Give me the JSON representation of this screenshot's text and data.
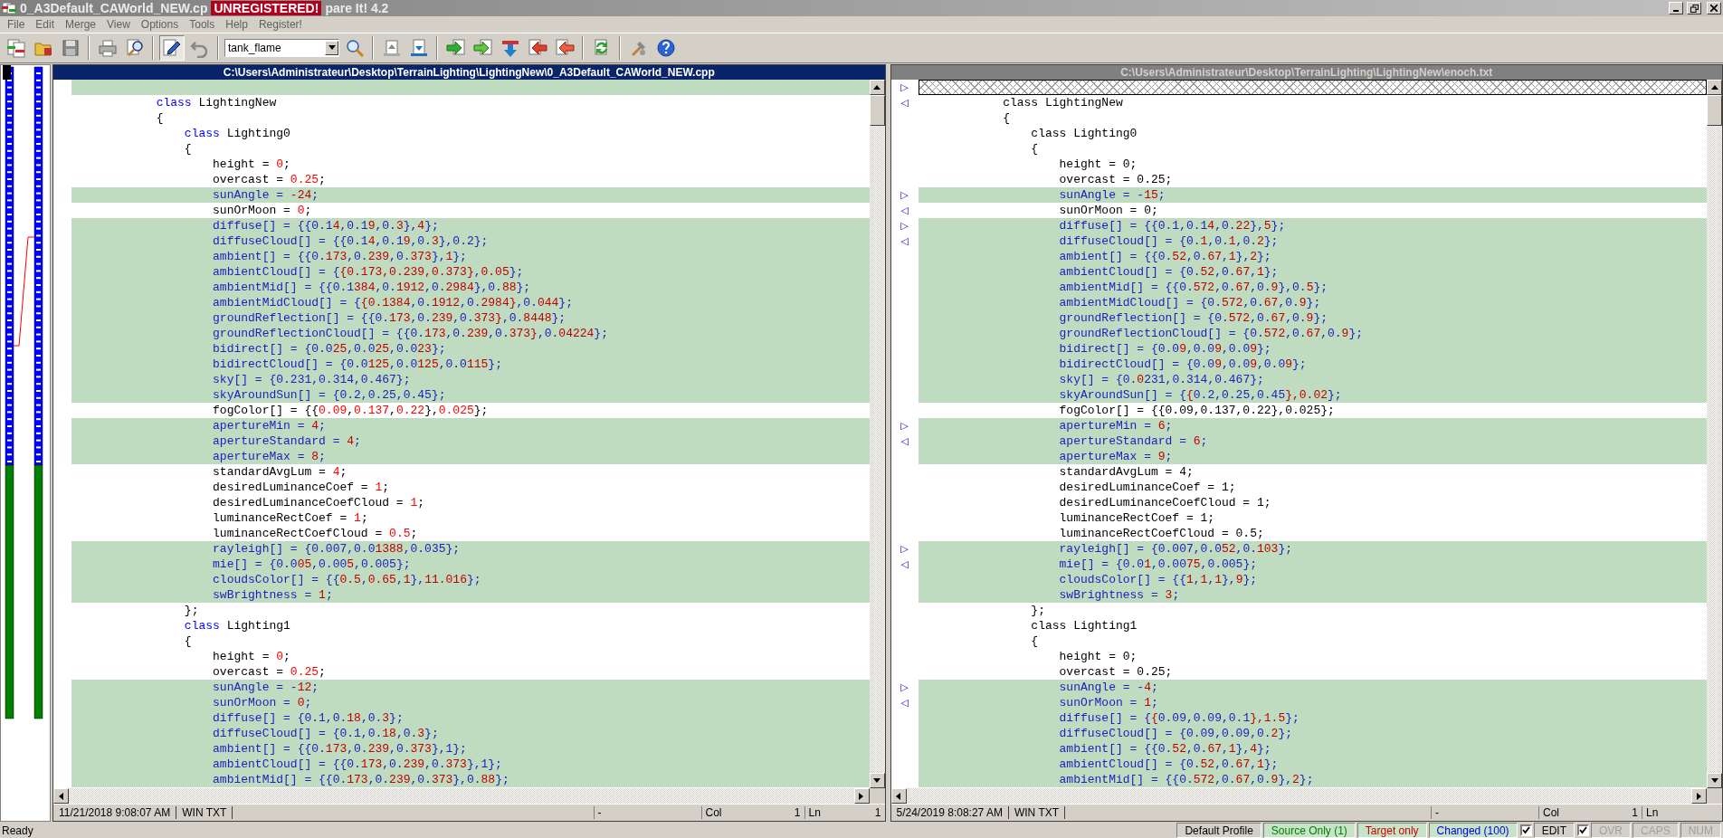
{
  "window": {
    "title": "0_A3Default_CAWorld_NEW.cp",
    "badge": "UNREGISTERED!",
    "title_end": "pare It! 4.2"
  },
  "menu": [
    "File",
    "Edit",
    "Merge",
    "View",
    "Options",
    "Tools",
    "Help",
    "Register!"
  ],
  "toolbar": {
    "search_text": "tank_flame",
    "edit_pressed": true
  },
  "panes": [
    {
      "path": "C:\\Users\\Administrateur\\Desktop\\TerrainLighting\\LightingNew\\0_A3Default_CAWorld_NEW.cpp",
      "active": true,
      "lines": [
        {
          "kind": "changed"
        },
        {
          "kind": "same",
          "parts": [
            {
              "text": "            class",
              "kind": "keyword"
            },
            {
              "text": " LightingNew"
            }
          ]
        },
        {
          "kind": "same",
          "parts": [
            {
              "text": "            {"
            }
          ]
        },
        {
          "kind": "same",
          "parts": [
            {
              "text": "                class",
              "kind": "keyword"
            },
            {
              "text": " Lighting0"
            }
          ]
        },
        {
          "kind": "same",
          "parts": [
            {
              "text": "                {"
            }
          ]
        },
        {
          "kind": "same",
          "parts": [
            {
              "text": "                    height = "
            },
            {
              "text": "0",
              "kind": "number"
            },
            {
              "text": ";"
            }
          ]
        },
        {
          "kind": "same",
          "parts": [
            {
              "text": "                    overcast = "
            },
            {
              "text": "0.25",
              "kind": "number"
            },
            {
              "text": ";"
            }
          ]
        },
        {
          "kind": "changed",
          "parts": [
            {
              "text": "                    sunAngle = "
            },
            {
              "text": "-24",
              "kind": "diff"
            },
            {
              "text": ";"
            }
          ]
        },
        {
          "kind": "same",
          "parts": [
            {
              "text": "                    sunOrMoon = "
            },
            {
              "text": "0",
              "kind": "number"
            },
            {
              "text": ";"
            }
          ]
        },
        {
          "kind": "changed",
          "parts": [
            {
              "text": "                    diffuse[] = {{0.1"
            },
            {
              "text": "4",
              "kind": "diff"
            },
            {
              "text": ",0.1"
            },
            {
              "text": "9",
              "kind": "diff"
            },
            {
              "text": ",0."
            },
            {
              "text": "3",
              "kind": "diff"
            },
            {
              "text": "},"
            },
            {
              "text": "4",
              "kind": "diff"
            },
            {
              "text": "};"
            }
          ]
        },
        {
          "kind": "changed",
          "parts": [
            {
              "text": "                    diffuseCloud[] = {{0.1"
            },
            {
              "text": "4",
              "kind": "diff"
            },
            {
              "text": ",0.1"
            },
            {
              "text": "9",
              "kind": "diff"
            },
            {
              "text": ",0."
            },
            {
              "text": "3",
              "kind": "diff"
            },
            {
              "text": "},0.2};"
            }
          ]
        },
        {
          "kind": "changed",
          "parts": [
            {
              "text": "                    ambient[] = {{0."
            },
            {
              "text": "173",
              "kind": "diff"
            },
            {
              "text": ",0."
            },
            {
              "text": "239",
              "kind": "diff"
            },
            {
              "text": ",0."
            },
            {
              "text": "373",
              "kind": "diff"
            },
            {
              "text": "},"
            },
            {
              "text": "1",
              "kind": "diff"
            },
            {
              "text": "};"
            }
          ]
        },
        {
          "kind": "changed",
          "parts": [
            {
              "text": "                    ambientCloud[] = {"
            },
            {
              "text": "{0.173,0.239,0.373}",
              "kind": "diff"
            },
            {
              "text": ","
            },
            {
              "text": "0.05",
              "kind": "diff"
            },
            {
              "text": "};"
            }
          ]
        },
        {
          "kind": "changed",
          "parts": [
            {
              "text": "                    ambientMid[] = {{0.1"
            },
            {
              "text": "384",
              "kind": "diff"
            },
            {
              "text": ",0."
            },
            {
              "text": "1912",
              "kind": "diff"
            },
            {
              "text": ",0."
            },
            {
              "text": "2984",
              "kind": "diff"
            },
            {
              "text": "},0."
            },
            {
              "text": "88",
              "kind": "diff"
            },
            {
              "text": "};"
            }
          ]
        },
        {
          "kind": "changed",
          "parts": [
            {
              "text": "                    ambientMidCloud[] = {"
            },
            {
              "text": "{0.1384",
              "kind": "diff"
            },
            {
              "text": ",0."
            },
            {
              "text": "1912",
              "kind": "diff"
            },
            {
              "text": ",0."
            },
            {
              "text": "2984}",
              "kind": "diff"
            },
            {
              "text": ",0."
            },
            {
              "text": "044",
              "kind": "diff"
            },
            {
              "text": "};"
            }
          ]
        },
        {
          "kind": "changed",
          "parts": [
            {
              "text": "                    groundReflection[] = {{0."
            },
            {
              "text": "173",
              "kind": "diff"
            },
            {
              "text": ",0."
            },
            {
              "text": "239",
              "kind": "diff"
            },
            {
              "text": ",0."
            },
            {
              "text": "373}",
              "kind": "diff"
            },
            {
              "text": ",0."
            },
            {
              "text": "8448",
              "kind": "diff"
            },
            {
              "text": "};"
            }
          ]
        },
        {
          "kind": "changed",
          "parts": [
            {
              "text": "                    groundReflectionCloud[] = {{0."
            },
            {
              "text": "173",
              "kind": "diff"
            },
            {
              "text": ",0."
            },
            {
              "text": "239",
              "kind": "diff"
            },
            {
              "text": ",0."
            },
            {
              "text": "373}",
              "kind": "diff"
            },
            {
              "text": ",0."
            },
            {
              "text": "04224",
              "kind": "diff"
            },
            {
              "text": "};"
            }
          ]
        },
        {
          "kind": "changed",
          "parts": [
            {
              "text": "                    bidirect[] = {0.0"
            },
            {
              "text": "25",
              "kind": "diff"
            },
            {
              "text": ",0.0"
            },
            {
              "text": "25",
              "kind": "diff"
            },
            {
              "text": ",0.0"
            },
            {
              "text": "23",
              "kind": "diff"
            },
            {
              "text": "};"
            }
          ]
        },
        {
          "kind": "changed",
          "parts": [
            {
              "text": "                    bidirectCloud[] = {0.0"
            },
            {
              "text": "125",
              "kind": "diff"
            },
            {
              "text": ",0.0"
            },
            {
              "text": "125",
              "kind": "diff"
            },
            {
              "text": ",0.0"
            },
            {
              "text": "115",
              "kind": "diff"
            },
            {
              "text": "};"
            }
          ]
        },
        {
          "kind": "changed",
          "parts": [
            {
              "text": "                    sky[] = {0.231,0.314,0.467};"
            }
          ]
        },
        {
          "kind": "changed",
          "parts": [
            {
              "text": "                    skyAroundSun[] = {0.2,0.25,0.45};"
            }
          ]
        },
        {
          "kind": "same",
          "parts": [
            {
              "text": "                    fogColor[] = {{"
            },
            {
              "text": "0.09",
              "kind": "number"
            },
            {
              "text": ","
            },
            {
              "text": "0.137",
              "kind": "number"
            },
            {
              "text": ","
            },
            {
              "text": "0.22",
              "kind": "number"
            },
            {
              "text": "},"
            },
            {
              "text": "0.025",
              "kind": "number"
            },
            {
              "text": "};"
            }
          ]
        },
        {
          "kind": "changed",
          "parts": [
            {
              "text": "                    apertureMin = "
            },
            {
              "text": "4",
              "kind": "diff"
            },
            {
              "text": ";"
            }
          ]
        },
        {
          "kind": "changed",
          "parts": [
            {
              "text": "                    apertureStandard = "
            },
            {
              "text": "4",
              "kind": "diff"
            },
            {
              "text": ";"
            }
          ]
        },
        {
          "kind": "changed",
          "parts": [
            {
              "text": "                    apertureMax = "
            },
            {
              "text": "8",
              "kind": "diff"
            },
            {
              "text": ";"
            }
          ]
        },
        {
          "kind": "same",
          "parts": [
            {
              "text": "                    standardAvgLum = "
            },
            {
              "text": "4",
              "kind": "number"
            },
            {
              "text": ";"
            }
          ]
        },
        {
          "kind": "same",
          "parts": [
            {
              "text": "                    desiredLuminanceCoef = "
            },
            {
              "text": "1",
              "kind": "number"
            },
            {
              "text": ";"
            }
          ]
        },
        {
          "kind": "same",
          "parts": [
            {
              "text": "                    desiredLuminanceCoefCloud = "
            },
            {
              "text": "1",
              "kind": "number"
            },
            {
              "text": ";"
            }
          ]
        },
        {
          "kind": "same",
          "parts": [
            {
              "text": "                    luminanceRectCoef = "
            },
            {
              "text": "1",
              "kind": "number"
            },
            {
              "text": ";"
            }
          ]
        },
        {
          "kind": "same",
          "parts": [
            {
              "text": "                    luminanceRectCoefCloud = "
            },
            {
              "text": "0.5",
              "kind": "number"
            },
            {
              "text": ";"
            }
          ]
        },
        {
          "kind": "changed",
          "parts": [
            {
              "text": "                    rayleigh[] = {0.007,0.0"
            },
            {
              "text": "1388",
              "kind": "diff"
            },
            {
              "text": ",0.035};"
            }
          ]
        },
        {
          "kind": "changed",
          "parts": [
            {
              "text": "                    mie[] = {0.0"
            },
            {
              "text": "05",
              "kind": "diff"
            },
            {
              "text": ",0.00"
            },
            {
              "text": "5",
              "kind": "diff"
            },
            {
              "text": ",0.005};"
            }
          ]
        },
        {
          "kind": "changed",
          "parts": [
            {
              "text": "                    cloudsColor[] = {{"
            },
            {
              "text": "0.5",
              "kind": "diff"
            },
            {
              "text": ","
            },
            {
              "text": "0.65",
              "kind": "diff"
            },
            {
              "text": ","
            },
            {
              "text": "1",
              "kind": "diff"
            },
            {
              "text": "},"
            },
            {
              "text": "11.016",
              "kind": "diff"
            },
            {
              "text": "};"
            }
          ]
        },
        {
          "kind": "changed",
          "parts": [
            {
              "text": "                    swBrightness = "
            },
            {
              "text": "1",
              "kind": "diff"
            },
            {
              "text": ";"
            }
          ]
        },
        {
          "kind": "same",
          "parts": [
            {
              "text": "                };"
            }
          ]
        },
        {
          "kind": "same",
          "parts": [
            {
              "text": "                class",
              "kind": "keyword"
            },
            {
              "text": " Lighting1"
            }
          ]
        },
        {
          "kind": "same",
          "parts": [
            {
              "text": "                {"
            }
          ]
        },
        {
          "kind": "same",
          "parts": [
            {
              "text": "                    height = "
            },
            {
              "text": "0",
              "kind": "number"
            },
            {
              "text": ";"
            }
          ]
        },
        {
          "kind": "same",
          "parts": [
            {
              "text": "                    overcast = "
            },
            {
              "text": "0.25",
              "kind": "number"
            },
            {
              "text": ";"
            }
          ]
        },
        {
          "kind": "changed",
          "parts": [
            {
              "text": "                    sunAngle = -"
            },
            {
              "text": "12",
              "kind": "diff"
            },
            {
              "text": ";"
            }
          ]
        },
        {
          "kind": "changed",
          "parts": [
            {
              "text": "                    sunOrMoon = "
            },
            {
              "text": "0",
              "kind": "diff"
            },
            {
              "text": ";"
            }
          ]
        },
        {
          "kind": "changed",
          "parts": [
            {
              "text": "                    diffuse[] = {0.1,0."
            },
            {
              "text": "18",
              "kind": "diff"
            },
            {
              "text": ",0."
            },
            {
              "text": "3",
              "kind": "diff"
            },
            {
              "text": "};"
            }
          ]
        },
        {
          "kind": "changed",
          "parts": [
            {
              "text": "                    diffuseCloud[] = {0.1,0."
            },
            {
              "text": "18",
              "kind": "diff"
            },
            {
              "text": ",0."
            },
            {
              "text": "3",
              "kind": "diff"
            },
            {
              "text": "};"
            }
          ]
        },
        {
          "kind": "changed",
          "parts": [
            {
              "text": "                    ambient[] = {{0."
            },
            {
              "text": "173",
              "kind": "diff"
            },
            {
              "text": ",0."
            },
            {
              "text": "239",
              "kind": "diff"
            },
            {
              "text": ",0."
            },
            {
              "text": "373",
              "kind": "diff"
            },
            {
              "text": "},1};"
            }
          ]
        },
        {
          "kind": "changed",
          "parts": [
            {
              "text": "                    ambientCloud[] = {{0."
            },
            {
              "text": "173",
              "kind": "diff"
            },
            {
              "text": ",0."
            },
            {
              "text": "239",
              "kind": "diff"
            },
            {
              "text": ",0."
            },
            {
              "text": "373",
              "kind": "diff"
            },
            {
              "text": "},1};"
            }
          ]
        },
        {
          "kind": "changed",
          "parts": [
            {
              "text": "                    ambientMid[] = {{0."
            },
            {
              "text": "173",
              "kind": "diff"
            },
            {
              "text": ",0."
            },
            {
              "text": "239",
              "kind": "diff"
            },
            {
              "text": ",0."
            },
            {
              "text": "373",
              "kind": "diff"
            },
            {
              "text": "},0."
            },
            {
              "text": "88",
              "kind": "diff"
            },
            {
              "text": "};"
            }
          ]
        }
      ],
      "status": {
        "date": "11/21/2018  9:08:07 AM",
        "format": "WIN TXT",
        "position": "-",
        "col_label": "Col",
        "col_value": "1",
        "ln_label": "Ln",
        "ln_value": "1"
      }
    },
    {
      "path": "C:\\Users\\Administrateur\\Desktop\\TerrainLighting\\LightingNew\\enoch.txt",
      "active": false,
      "lines": [
        {
          "kind": "missing",
          "marker": "▷"
        },
        {
          "kind": "same",
          "marker": "◁",
          "parts": [
            {
              "text": "            class LightingNew"
            }
          ]
        },
        {
          "kind": "same",
          "parts": [
            {
              "text": "            {"
            }
          ]
        },
        {
          "kind": "same",
          "parts": [
            {
              "text": "                class Lighting0"
            }
          ]
        },
        {
          "kind": "same",
          "parts": [
            {
              "text": "                {"
            }
          ]
        },
        {
          "kind": "same",
          "parts": [
            {
              "text": "                    height = 0;"
            }
          ]
        },
        {
          "kind": "same",
          "parts": [
            {
              "text": "                    overcast = 0.25;"
            }
          ]
        },
        {
          "kind": "changed",
          "marker": "▷",
          "parts": [
            {
              "text": "                    sunAngle = -"
            },
            {
              "text": "15",
              "kind": "diff"
            },
            {
              "text": ";"
            }
          ]
        },
        {
          "kind": "same",
          "marker": "◁",
          "parts": [
            {
              "text": "                    sunOrMoon = 0;"
            }
          ]
        },
        {
          "kind": "changed",
          "marker": "▷",
          "parts": [
            {
              "text": "                    diffuse[] = {{0.1,0.1"
            },
            {
              "text": "4",
              "kind": "diff"
            },
            {
              "text": ",0."
            },
            {
              "text": "22",
              "kind": "diff"
            },
            {
              "text": "},"
            },
            {
              "text": "5",
              "kind": "diff"
            },
            {
              "text": "};"
            }
          ]
        },
        {
          "kind": "changed",
          "marker": "◁",
          "parts": [
            {
              "text": "                    diffuseCloud[] = {0."
            },
            {
              "text": "1",
              "kind": "diff"
            },
            {
              "text": ",0."
            },
            {
              "text": "1",
              "kind": "diff"
            },
            {
              "text": ",0."
            },
            {
              "text": "2",
              "kind": "diff"
            },
            {
              "text": "};"
            }
          ]
        },
        {
          "kind": "changed",
          "parts": [
            {
              "text": "                    ambient[] = {{0."
            },
            {
              "text": "52",
              "kind": "diff"
            },
            {
              "text": ",0."
            },
            {
              "text": "67",
              "kind": "diff"
            },
            {
              "text": ","
            },
            {
              "text": "1",
              "kind": "diff"
            },
            {
              "text": "},"
            },
            {
              "text": "2",
              "kind": "diff"
            },
            {
              "text": "};"
            }
          ]
        },
        {
          "kind": "changed",
          "parts": [
            {
              "text": "                    ambientCloud[] = {0."
            },
            {
              "text": "52",
              "kind": "diff"
            },
            {
              "text": ",0."
            },
            {
              "text": "67",
              "kind": "diff"
            },
            {
              "text": ","
            },
            {
              "text": "1",
              "kind": "diff"
            },
            {
              "text": "};"
            }
          ]
        },
        {
          "kind": "changed",
          "parts": [
            {
              "text": "                    ambientMid[] = {{0."
            },
            {
              "text": "572",
              "kind": "diff"
            },
            {
              "text": ",0."
            },
            {
              "text": "67",
              "kind": "diff"
            },
            {
              "text": ",0."
            },
            {
              "text": "9",
              "kind": "diff"
            },
            {
              "text": "},0."
            },
            {
              "text": "5",
              "kind": "diff"
            },
            {
              "text": "};"
            }
          ]
        },
        {
          "kind": "changed",
          "parts": [
            {
              "text": "                    ambientMidCloud[] = {0."
            },
            {
              "text": "572",
              "kind": "diff"
            },
            {
              "text": ",0."
            },
            {
              "text": "67",
              "kind": "diff"
            },
            {
              "text": ",0."
            },
            {
              "text": "9",
              "kind": "diff"
            },
            {
              "text": "};"
            }
          ]
        },
        {
          "kind": "changed",
          "parts": [
            {
              "text": "                    groundReflection[] = {0."
            },
            {
              "text": "572",
              "kind": "diff"
            },
            {
              "text": ",0."
            },
            {
              "text": "67",
              "kind": "diff"
            },
            {
              "text": ",0."
            },
            {
              "text": "9",
              "kind": "diff"
            },
            {
              "text": "};"
            }
          ]
        },
        {
          "kind": "changed",
          "parts": [
            {
              "text": "                    groundReflectionCloud[] = {0."
            },
            {
              "text": "572",
              "kind": "diff"
            },
            {
              "text": ",0."
            },
            {
              "text": "67",
              "kind": "diff"
            },
            {
              "text": ",0."
            },
            {
              "text": "9",
              "kind": "diff"
            },
            {
              "text": "};"
            }
          ]
        },
        {
          "kind": "changed",
          "parts": [
            {
              "text": "                    bidirect[] = {0.0"
            },
            {
              "text": "9",
              "kind": "diff"
            },
            {
              "text": ",0.0"
            },
            {
              "text": "9",
              "kind": "diff"
            },
            {
              "text": ",0.0"
            },
            {
              "text": "9",
              "kind": "diff"
            },
            {
              "text": "};"
            }
          ]
        },
        {
          "kind": "changed",
          "parts": [
            {
              "text": "                    bidirectCloud[] = {0.0"
            },
            {
              "text": "9",
              "kind": "diff"
            },
            {
              "text": ",0.0"
            },
            {
              "text": "9",
              "kind": "diff"
            },
            {
              "text": ",0.0"
            },
            {
              "text": "9",
              "kind": "diff"
            },
            {
              "text": "};"
            }
          ]
        },
        {
          "kind": "changed",
          "parts": [
            {
              "text": "                    sky[] = {0."
            },
            {
              "text": "0",
              "kind": "diff"
            },
            {
              "text": "231,0.314,0.467};"
            }
          ]
        },
        {
          "kind": "changed",
          "parts": [
            {
              "text": "                    skyAroundSun[] = {"
            },
            {
              "text": "{",
              "kind": "diff"
            },
            {
              "text": "0.2,0.25,0.45"
            },
            {
              "text": "},0.02",
              "kind": "diff"
            },
            {
              "text": "};"
            }
          ]
        },
        {
          "kind": "same",
          "parts": [
            {
              "text": "                    fogColor[] = {{0.09,0.137,0.22},0.025};"
            }
          ]
        },
        {
          "kind": "changed",
          "marker": "▷",
          "parts": [
            {
              "text": "                    apertureMin = "
            },
            {
              "text": "6",
              "kind": "diff"
            },
            {
              "text": ";"
            }
          ]
        },
        {
          "kind": "changed",
          "marker": "◁",
          "parts": [
            {
              "text": "                    apertureStandard = "
            },
            {
              "text": "6",
              "kind": "diff"
            },
            {
              "text": ";"
            }
          ]
        },
        {
          "kind": "changed",
          "parts": [
            {
              "text": "                    apertureMax = "
            },
            {
              "text": "9",
              "kind": "diff"
            },
            {
              "text": ";"
            }
          ]
        },
        {
          "kind": "same",
          "parts": [
            {
              "text": "                    standardAvgLum = 4;"
            }
          ]
        },
        {
          "kind": "same",
          "parts": [
            {
              "text": "                    desiredLuminanceCoef = 1;"
            }
          ]
        },
        {
          "kind": "same",
          "parts": [
            {
              "text": "                    desiredLuminanceCoefCloud = 1;"
            }
          ]
        },
        {
          "kind": "same",
          "parts": [
            {
              "text": "                    luminanceRectCoef = 1;"
            }
          ]
        },
        {
          "kind": "same",
          "parts": [
            {
              "text": "                    luminanceRectCoefCloud = 0.5;"
            }
          ]
        },
        {
          "kind": "changed",
          "marker": "▷",
          "parts": [
            {
              "text": "                    rayleigh[] = {0.007,0.0"
            },
            {
              "text": "52",
              "kind": "diff"
            },
            {
              "text": ",0."
            },
            {
              "text": "103",
              "kind": "diff"
            },
            {
              "text": "};"
            }
          ]
        },
        {
          "kind": "changed",
          "marker": "◁",
          "parts": [
            {
              "text": "                    mie[] = {0.0"
            },
            {
              "text": "1",
              "kind": "diff"
            },
            {
              "text": ",0.00"
            },
            {
              "text": "75",
              "kind": "diff"
            },
            {
              "text": ",0.005};"
            }
          ]
        },
        {
          "kind": "changed",
          "parts": [
            {
              "text": "                    cloudsColor[] = {{"
            },
            {
              "text": "1",
              "kind": "diff"
            },
            {
              "text": ","
            },
            {
              "text": "1",
              "kind": "diff"
            },
            {
              "text": ","
            },
            {
              "text": "1",
              "kind": "diff"
            },
            {
              "text": "},"
            },
            {
              "text": "9",
              "kind": "diff"
            },
            {
              "text": "};"
            }
          ]
        },
        {
          "kind": "changed",
          "parts": [
            {
              "text": "                    swBrightness = "
            },
            {
              "text": "3",
              "kind": "diff"
            },
            {
              "text": ";"
            }
          ]
        },
        {
          "kind": "same",
          "parts": [
            {
              "text": "                };"
            }
          ]
        },
        {
          "kind": "same",
          "parts": [
            {
              "text": "                class Lighting1"
            }
          ]
        },
        {
          "kind": "same",
          "parts": [
            {
              "text": "                {"
            }
          ]
        },
        {
          "kind": "same",
          "parts": [
            {
              "text": "                    height = 0;"
            }
          ]
        },
        {
          "kind": "same",
          "parts": [
            {
              "text": "                    overcast = 0.25;"
            }
          ]
        },
        {
          "kind": "changed",
          "marker": "▷",
          "parts": [
            {
              "text": "                    sunAngle = -"
            },
            {
              "text": "4",
              "kind": "diff"
            },
            {
              "text": ";"
            }
          ]
        },
        {
          "kind": "changed",
          "marker": "◁",
          "parts": [
            {
              "text": "                    sunOrMoon = "
            },
            {
              "text": "1",
              "kind": "diff"
            },
            {
              "text": ";"
            }
          ]
        },
        {
          "kind": "changed",
          "parts": [
            {
              "text": "                    diffuse[] = {"
            },
            {
              "text": "{",
              "kind": "diff"
            },
            {
              "text": "0.09,0.09,0.1"
            },
            {
              "text": "},1.5",
              "kind": "diff"
            },
            {
              "text": "};"
            }
          ]
        },
        {
          "kind": "changed",
          "parts": [
            {
              "text": "                    diffuseCloud[] = {0.09,0.09,0."
            },
            {
              "text": "2",
              "kind": "diff"
            },
            {
              "text": "};"
            }
          ]
        },
        {
          "kind": "changed",
          "parts": [
            {
              "text": "                    ambient[] = {{0."
            },
            {
              "text": "52",
              "kind": "diff"
            },
            {
              "text": ",0."
            },
            {
              "text": "67",
              "kind": "diff"
            },
            {
              "text": ","
            },
            {
              "text": "1",
              "kind": "diff"
            },
            {
              "text": "},"
            },
            {
              "text": "4",
              "kind": "diff"
            },
            {
              "text": "};"
            }
          ]
        },
        {
          "kind": "changed",
          "parts": [
            {
              "text": "                    ambientCloud[] = {0."
            },
            {
              "text": "52",
              "kind": "diff"
            },
            {
              "text": ",0."
            },
            {
              "text": "67",
              "kind": "diff"
            },
            {
              "text": ","
            },
            {
              "text": "1",
              "kind": "diff"
            },
            {
              "text": "};"
            }
          ]
        },
        {
          "kind": "changed",
          "parts": [
            {
              "text": "                    ambientMid[] = {{0."
            },
            {
              "text": "572",
              "kind": "diff"
            },
            {
              "text": ",0."
            },
            {
              "text": "67",
              "kind": "diff"
            },
            {
              "text": ",0."
            },
            {
              "text": "9",
              "kind": "diff"
            },
            {
              "text": "},"
            },
            {
              "text": "2",
              "kind": "diff"
            },
            {
              "text": "};"
            }
          ]
        }
      ],
      "status": {
        "date": "5/24/2019  8:08:27 AM",
        "format": "WIN TXT",
        "position": "-",
        "col_label": "Col",
        "col_value": "1",
        "ln_label": "Ln"
      }
    }
  ],
  "status_bar": {
    "message": "Ready",
    "items": [
      {
        "kind": "panel",
        "text": "Default Profile",
        "disabled": false
      },
      {
        "kind": "panel",
        "text": "Source Only (1)",
        "color": "#008000",
        "disabled": false
      },
      {
        "kind": "panel",
        "text": "Target only",
        "color": "#d00000",
        "disabled": false
      },
      {
        "kind": "panel",
        "text": "Changed (100)",
        "color": "#0000e0",
        "disabled": false
      },
      {
        "kind": "checkbox",
        "checked": true
      },
      {
        "kind": "panel",
        "text": "EDIT",
        "disabled": false
      },
      {
        "kind": "checkbox",
        "checked": true
      },
      {
        "kind": "panel",
        "text": "OVR",
        "disabled": true
      },
      {
        "kind": "panel",
        "text": "CAPS",
        "disabled": true
      },
      {
        "kind": "panel",
        "text": "NUM",
        "disabled": true
      }
    ]
  }
}
